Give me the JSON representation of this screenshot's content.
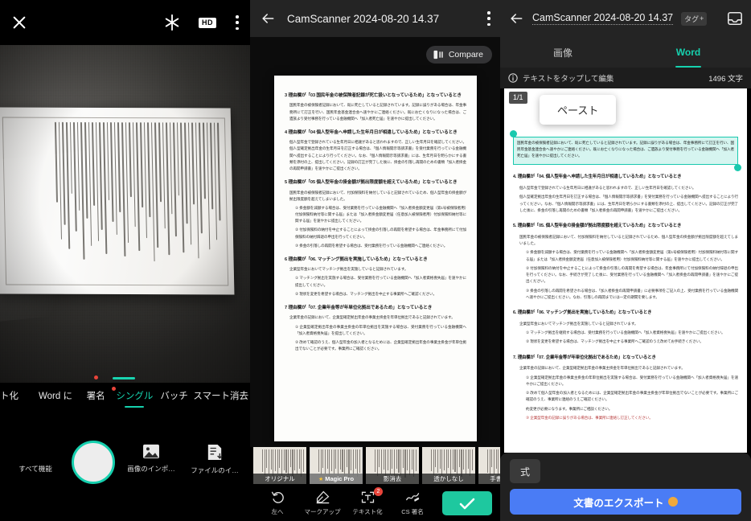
{
  "panel_camera": {
    "topbar": {
      "close_icon": "close-icon",
      "flash_icon": "flash-off-icon",
      "hd_label": "HD",
      "more_icon": "overflow-menu-icon"
    },
    "modes": [
      {
        "label": "ト化",
        "active": false,
        "dot": false
      },
      {
        "label": "Word に",
        "active": false,
        "dot": false
      },
      {
        "label": "署名",
        "active": false,
        "dot": true
      },
      {
        "label": "シングル",
        "active": true,
        "dot": false
      },
      {
        "label": "バッチ",
        "active": false,
        "dot": false
      },
      {
        "label": "スマート消去",
        "active": false,
        "dot": false
      }
    ],
    "actions": {
      "all_features": "すべて機能",
      "shutter": "shutter-button",
      "import_image": "画像のインポ…",
      "import_file": "ファイルのイ…"
    }
  },
  "panel_edit": {
    "topbar": {
      "back_icon": "back-arrow-icon",
      "title": "CamScanner 2024-08-20 14.37",
      "more_icon": "overflow-menu-icon"
    },
    "compare_label": "Compare",
    "document": {
      "sections": [
        {
          "heading": "3 理由欄が「03 国民年金の被保険者記録が死亡扱いとなっているため」となっているとき",
          "paras": [
            "国民年金の被保険者記録において、既に死亡していると記録されています。記録に誤りがある場合は、年金事務所にて訂正を行い、国民年金基金連合会へ速やかにご連絡ください。既にお亡くなりになった場合は、ご遺族より受付事務を行っている金融機関へ「加入者死亡届」を速やかに提出してください。"
          ]
        },
        {
          "heading": "4 理由欄が「04 個人型年金へ申請した生年月日が相違しているため」となっているとき",
          "paras": [
            "個人型年金で登録されている生年月日に相違があると思われますので、正しい生年月日を確認してください。個人型確定拠出年金の生年月日を訂正する場合は、「個人情報開示等請求書」を受付業務を行っている金融機関へ提出することにより行ってください。なお、「個人情報開示等請求書」には、生年月日を明らかにする書類を添付の上、提出してください。記録の訂正が完了した後に、掛金の引落し再開のための書類「加入者掛金の再開申請書」を速やかにご提出ください。"
          ]
        },
        {
          "heading": "5 理由欄が「05 個人型年金の掛金額が拠出限度額を超えているため」となっているとき",
          "paras": [
            "国民年金の被保険者記録において、付加保険料を納付していると記録されているため、個人型年金の掛金額が拠出限度額を超えてしまいました。",
            "① 掛金額を減額する場合は、受付業務を行っている金融機関へ「加入者掛金額変更届（第1号被保険者用）付加保険料納付等に関する届」または「加入者掛金額変更届（任意加入被保険者用）付加保険料納付等に関する届」を速やかに提出してください。",
            "② 付加保険料の納付を中止することによって掛金の引落しの再開を希望する場合は、年金事務所にて付加保険料の納付辞退の申出を行ってください。",
            "③ 掛金の引落しの再開を希望する場合は、受付業務を行っている金融機関へご連絡ください。"
          ]
        },
        {
          "heading": "6 理由欄が「06. マッチング拠出を実施しているため」となっているとき",
          "paras": [
            "企業型年金においてマッチング拠出を実施していると記録されています。",
            "① マッチング拠出を実施する場合は、受付業務を行っている金融機関へ「加入者資格喪失届」を速やかに提出してください。",
            "② 現状を変更を希望する場合は、マッチング拠出を中止する事業所へご確認ください。"
          ]
        },
        {
          "heading": "7 理由欄が「07. 企業年金等が年単位化拠出であるため」となっているとき",
          "paras": [
            "企業年金の記録において、企業型確定拠出年金の事業主掛金を年単位拠出であると記録されています。",
            "① 企業型確定拠出年金の事業主掛金の年単位拠出を実施する場合は、受付業務を行っている金融機関へ「加入者資格喪失届」を提出してください。",
            "② 改めて確認のうえ、個人型年金の加入者となるためには、企業型確定拠出年金の事業主掛金が年単位拠出でないことが必要です。事業所にご確認ください。"
          ]
        }
      ]
    },
    "filters": [
      {
        "label": "オリジナル",
        "selected": false,
        "pro": false
      },
      {
        "label": "Magic Pro",
        "selected": true,
        "pro": true
      },
      {
        "label": "影消去",
        "selected": false,
        "pro": false
      },
      {
        "label": "透かしなし",
        "selected": false,
        "pro": false
      },
      {
        "label": "手書きな…",
        "selected": false,
        "pro": false
      }
    ],
    "tools": [
      {
        "label": "左へ",
        "icon": "rotate-left-icon",
        "badge": ""
      },
      {
        "label": "マークアップ",
        "icon": "markup-pen-icon",
        "badge": ""
      },
      {
        "label": "テキスト化",
        "icon": "ocr-text-icon",
        "badge": "2"
      },
      {
        "label": "CS 署名",
        "icon": "signature-icon",
        "badge": ""
      }
    ],
    "confirm_icon": "check-icon"
  },
  "panel_word": {
    "topbar": {
      "back_icon": "back-arrow-icon",
      "title": "CamScanner 2024-08-20 14.37",
      "tag_label": "タグ",
      "tag_plus": "+",
      "save_icon": "save-to-inbox-icon"
    },
    "tabs": [
      {
        "label": "画像",
        "active": false
      },
      {
        "label": "Word",
        "active": true
      }
    ],
    "hint": {
      "info_icon": "info-icon",
      "text": "テキストをタップして編集",
      "count": "1496 文字"
    },
    "page_badge": "1/1",
    "paste_popup": "ペースト",
    "document": {
      "selected_text": "国民年金の被保険者記録において、既に死亡していると記録されています。記録に誤りがある場合は、年金事務所にて訂正を行い、国民年金基金連合会へ速やかにご連絡ください。既にお亡くなりになった場合は、ご遺族より受付事務を行っている金融機関へ「加入者死亡届」を速やかに提出してください。",
      "sections": [
        {
          "heading": "4. 理由欄が「04. 個人型年金へ申請した生年月日が相違しているため」となっているとき",
          "paras": [
            "個人型年金で登録されている生年月日に相違があると思われますので、正しい生年月日を確認してください。",
            "個人型確定拠出年金の生年月日を訂正する場合は、「個人情報開示等請求書」を受付業務を行っている金融機関へ提出することにより行ってください。なお、「個人情報開示等請求書」には、生年月日を明らかにする書類を添付の上、提出してください。記録の訂正が完了した後に、掛金の引落し再開のための書類「加入者掛金の再開申請書」を速やかにご提出ください。"
          ]
        },
        {
          "heading": "5. 理由欄が「05. 個人型年金の掛金額が拠出限度額を超えているため」となっているとき",
          "paras": [
            "国民年金の被保険者記録において、付加保険料を納付していると記録されているため、個人型年金の掛金額が拠出限度額を超えてしまいました。",
            "① 掛金額を減額する場合は、受付業務を行っている金融機関へ「加入者掛金額変更届（第1号被保険者用）付加保険料納付等に関する届」または「加入者掛金額変更届（任意加入被保険者用）付加保険料納付等に関する届」を速やかに提出してください。",
            "② 付加保険料の納付を中止することによって掛金の引落しの再開を希望する場合は、年金事務所にて付加保険料の納付辞退の申出を行ってください。なお、手続きが完了した後に、受付業務を行っている金融機関へ「加入者掛金の再開申請書」を速やかにご提出ください。",
            "③ 掛金の引落しの再開を希望される場合は、「加入者掛金の再開申請書」に必要事項をご記入の上、受付業務を行っている金融機関へ速やかにご提出ください。なお、引落しの再開までには一定の期間を要します。"
          ]
        },
        {
          "heading": "6. 理由欄が「06. マッチング拠出を実施しているため」となっているとき",
          "paras": [
            "企業型年金においてマッチング拠出を実施していると記録されています。",
            "① マッチング拠出を継続する場合は、受付業務を行っている金融機関へ「加入者資格喪失届」を速やかにご提出ください。",
            "② 現状を変更を希望する場合は、マッチング拠出を中止する事業所へご確認のうえ改めてお手続きください。"
          ]
        },
        {
          "heading": "7. 理由欄が「07. 企業年金等が年単位化拠出であるため」となっているとき",
          "paras": [
            "企業年金の記録において、企業型確定拠出年金の事業主掛金を年単位拠出であると記録されています。",
            "① 企業型確定拠出年金の事業主掛金の年単位拠出を実施する場合は、受付業務を行っている金融機関へ「加入者資格喪失届」を速やかにご提出ください。",
            "② 改めて個人型年金の加入者となるためには、企業型確定拠出年金の事業主掛金が年単位拠出でないことが必要です。事業所にご確認のうえ、事業所に連絡のうえご確認ください。",
            "約変更が必要になります。事業所にご相談ください。",
            "③ 企業型年金の記録に誤りがある場合は、事業所に連絡し訂正してください。"
          ]
        }
      ]
    },
    "bottom": {
      "formula_label": "式",
      "export_label": "文書のエクスポート",
      "export_badge": "crown-icon"
    }
  },
  "colors": {
    "accent_teal": "#16d1ae",
    "accent_blue": "#4a7cf5",
    "badge_red": "#e8443a",
    "bar_dark": "#242424",
    "gold": "#f0a93c"
  }
}
